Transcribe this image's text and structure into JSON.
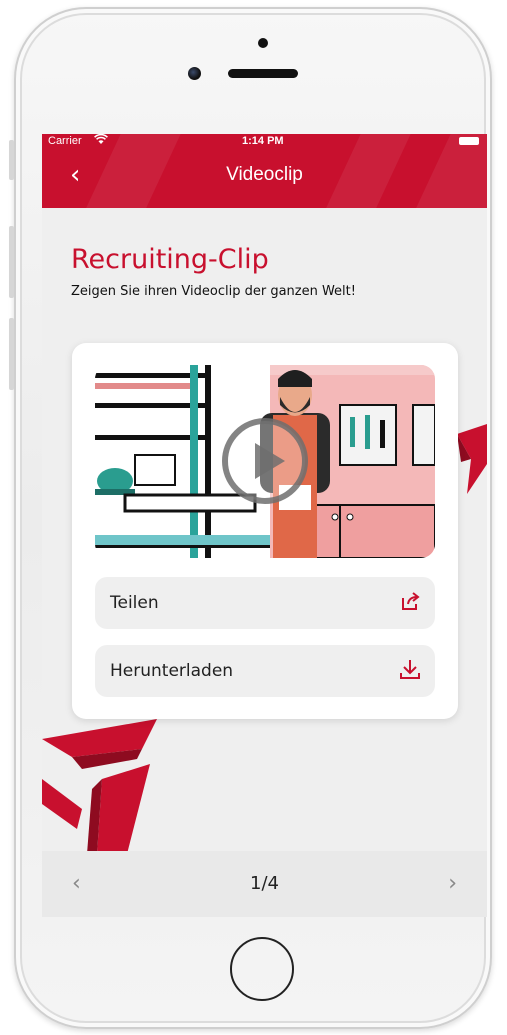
{
  "statusbar": {
    "carrier": "Carrier",
    "wifi_icon": "wifi-icon",
    "time": "1:14 PM",
    "battery_icon": "battery-icon"
  },
  "navbar": {
    "back_icon": "chevron-left-icon",
    "back_glyph": "‹",
    "title": "Videoclip"
  },
  "content": {
    "headline": "Recruiting-Clip",
    "subline": "Zeigen Sie ihren Videoclip der ganzen Welt!"
  },
  "video": {
    "play_icon": "play-icon"
  },
  "actions": [
    {
      "label": "Teilen",
      "icon": "share-icon"
    },
    {
      "label": "Herunterladen",
      "icon": "download-icon"
    }
  ],
  "pager": {
    "prev_glyph": "‹",
    "current": "1/4",
    "next_glyph": "›"
  },
  "colors": {
    "brand_red": "#c8102e",
    "background": "#efefef",
    "card": "#ffffff"
  }
}
